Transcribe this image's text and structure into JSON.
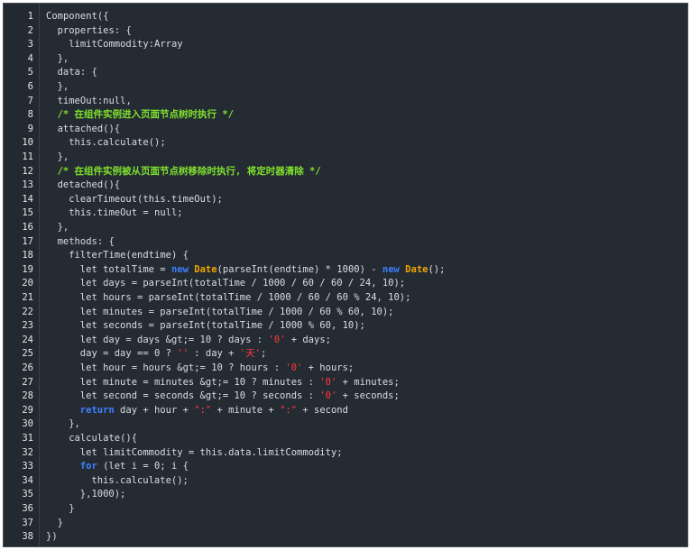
{
  "editor": {
    "theme_colors": {
      "background": "#252b33",
      "gutter": "#232930",
      "text": "#d8dee4",
      "keyword": "#3d7fff",
      "type": "#f0a500",
      "string": "#ff3b3b",
      "comment": "#7ee12e"
    },
    "lines": [
      {
        "n": "1",
        "indent": 0,
        "tokens": [
          {
            "t": "Component({",
            "c": "plain"
          }
        ]
      },
      {
        "n": "2",
        "indent": 1,
        "tokens": [
          {
            "t": "properties: {",
            "c": "plain"
          }
        ]
      },
      {
        "n": "3",
        "indent": 2,
        "tokens": [
          {
            "t": "limitCommodity:Array",
            "c": "plain"
          }
        ]
      },
      {
        "n": "4",
        "indent": 1,
        "tokens": [
          {
            "t": "},",
            "c": "plain"
          }
        ]
      },
      {
        "n": "5",
        "indent": 1,
        "tokens": [
          {
            "t": "data: {",
            "c": "plain"
          }
        ]
      },
      {
        "n": "6",
        "indent": 1,
        "tokens": [
          {
            "t": "},",
            "c": "plain"
          }
        ]
      },
      {
        "n": "7",
        "indent": 1,
        "tokens": [
          {
            "t": "timeOut:null,",
            "c": "plain"
          }
        ]
      },
      {
        "n": "8",
        "indent": 1,
        "tokens": [
          {
            "t": "/* 在组件实例进入页面节点树时执行 */",
            "c": "cmt"
          }
        ]
      },
      {
        "n": "9",
        "indent": 1,
        "tokens": [
          {
            "t": "attached(){",
            "c": "plain"
          }
        ]
      },
      {
        "n": "10",
        "indent": 2,
        "tokens": [
          {
            "t": "this.calculate();",
            "c": "plain"
          }
        ]
      },
      {
        "n": "11",
        "indent": 1,
        "tokens": [
          {
            "t": "},",
            "c": "plain"
          }
        ]
      },
      {
        "n": "12",
        "indent": 1,
        "tokens": [
          {
            "t": "/* 在组件实例被从页面节点树移除时执行, 将定时器清除 */",
            "c": "cmt"
          }
        ]
      },
      {
        "n": "13",
        "indent": 1,
        "tokens": [
          {
            "t": "detached(){",
            "c": "plain"
          }
        ]
      },
      {
        "n": "14",
        "indent": 2,
        "tokens": [
          {
            "t": "clearTimeout(this.timeOut);",
            "c": "plain"
          }
        ]
      },
      {
        "n": "15",
        "indent": 2,
        "tokens": [
          {
            "t": "this.timeOut = null;",
            "c": "plain"
          }
        ]
      },
      {
        "n": "16",
        "indent": 1,
        "tokens": [
          {
            "t": "},",
            "c": "plain"
          }
        ]
      },
      {
        "n": "17",
        "indent": 1,
        "tokens": [
          {
            "t": "methods: {",
            "c": "plain"
          }
        ]
      },
      {
        "n": "18",
        "indent": 2,
        "tokens": [
          {
            "t": "filterTime(endtime) {",
            "c": "plain"
          }
        ]
      },
      {
        "n": "19",
        "indent": 3,
        "tokens": [
          {
            "t": "let totalTime = ",
            "c": "plain"
          },
          {
            "t": "new",
            "c": "kw"
          },
          {
            "t": " ",
            "c": "plain"
          },
          {
            "t": "Date",
            "c": "type"
          },
          {
            "t": "(parseInt(endtime) * 1000) - ",
            "c": "plain"
          },
          {
            "t": "new",
            "c": "kw"
          },
          {
            "t": " ",
            "c": "plain"
          },
          {
            "t": "Date",
            "c": "type"
          },
          {
            "t": "();",
            "c": "plain"
          }
        ]
      },
      {
        "n": "20",
        "indent": 3,
        "tokens": [
          {
            "t": "let days = parseInt(totalTime / 1000 / 60 / 60 / 24, 10);",
            "c": "plain"
          }
        ]
      },
      {
        "n": "21",
        "indent": 3,
        "tokens": [
          {
            "t": "let hours = parseInt(totalTime / 1000 / 60 / 60 % 24, 10);",
            "c": "plain"
          }
        ]
      },
      {
        "n": "22",
        "indent": 3,
        "tokens": [
          {
            "t": "let minutes = parseInt(totalTime / 1000 / 60 % 60, 10);",
            "c": "plain"
          }
        ]
      },
      {
        "n": "23",
        "indent": 3,
        "tokens": [
          {
            "t": "let seconds = parseInt(totalTime / 1000 % 60, 10);",
            "c": "plain"
          }
        ]
      },
      {
        "n": "24",
        "indent": 3,
        "tokens": [
          {
            "t": "let day = days &gt;= 10 ? days : ",
            "c": "plain"
          },
          {
            "t": "'0'",
            "c": "str"
          },
          {
            "t": " + days;",
            "c": "plain"
          }
        ]
      },
      {
        "n": "25",
        "indent": 3,
        "tokens": [
          {
            "t": "day = day == 0 ? ",
            "c": "plain"
          },
          {
            "t": "''",
            "c": "str"
          },
          {
            "t": " : day + ",
            "c": "plain"
          },
          {
            "t": "'天'",
            "c": "str"
          },
          {
            "t": ";",
            "c": "plain"
          }
        ]
      },
      {
        "n": "26",
        "indent": 3,
        "tokens": [
          {
            "t": "let hour = hours &gt;= 10 ? hours : ",
            "c": "plain"
          },
          {
            "t": "'0'",
            "c": "str"
          },
          {
            "t": " + hours;",
            "c": "plain"
          }
        ]
      },
      {
        "n": "27",
        "indent": 3,
        "tokens": [
          {
            "t": "let minute = minutes &gt;= 10 ? minutes : ",
            "c": "plain"
          },
          {
            "t": "'0'",
            "c": "str"
          },
          {
            "t": " + minutes;",
            "c": "plain"
          }
        ]
      },
      {
        "n": "28",
        "indent": 3,
        "tokens": [
          {
            "t": "let second = seconds &gt;= 10 ? seconds : ",
            "c": "plain"
          },
          {
            "t": "'0'",
            "c": "str"
          },
          {
            "t": " + seconds;",
            "c": "plain"
          }
        ]
      },
      {
        "n": "29",
        "indent": 3,
        "tokens": [
          {
            "t": "return",
            "c": "kw"
          },
          {
            "t": " day + hour + ",
            "c": "plain"
          },
          {
            "t": "\":\"",
            "c": "str"
          },
          {
            "t": " + minute + ",
            "c": "plain"
          },
          {
            "t": "\":\"",
            "c": "str"
          },
          {
            "t": " + second",
            "c": "plain"
          }
        ]
      },
      {
        "n": "30",
        "indent": 2,
        "tokens": [
          {
            "t": "},",
            "c": "plain"
          }
        ]
      },
      {
        "n": "31",
        "indent": 2,
        "tokens": [
          {
            "t": "calculate(){",
            "c": "plain"
          }
        ]
      },
      {
        "n": "32",
        "indent": 3,
        "tokens": [
          {
            "t": "let limitCommodity = this.data.limitCommodity;",
            "c": "plain"
          }
        ]
      },
      {
        "n": "33",
        "indent": 3,
        "tokens": [
          {
            "t": "for",
            "c": "kw"
          },
          {
            "t": " (let i = 0; i {",
            "c": "plain"
          }
        ]
      },
      {
        "n": "34",
        "indent": 4,
        "tokens": [
          {
            "t": "this.calculate();",
            "c": "plain"
          }
        ]
      },
      {
        "n": "35",
        "indent": 3,
        "tokens": [
          {
            "t": "},1000);",
            "c": "plain"
          }
        ]
      },
      {
        "n": "36",
        "indent": 2,
        "tokens": [
          {
            "t": "}",
            "c": "plain"
          }
        ]
      },
      {
        "n": "37",
        "indent": 1,
        "tokens": [
          {
            "t": "}",
            "c": "plain"
          }
        ]
      },
      {
        "n": "38",
        "indent": 0,
        "tokens": [
          {
            "t": "})",
            "c": "plain"
          }
        ]
      }
    ]
  }
}
